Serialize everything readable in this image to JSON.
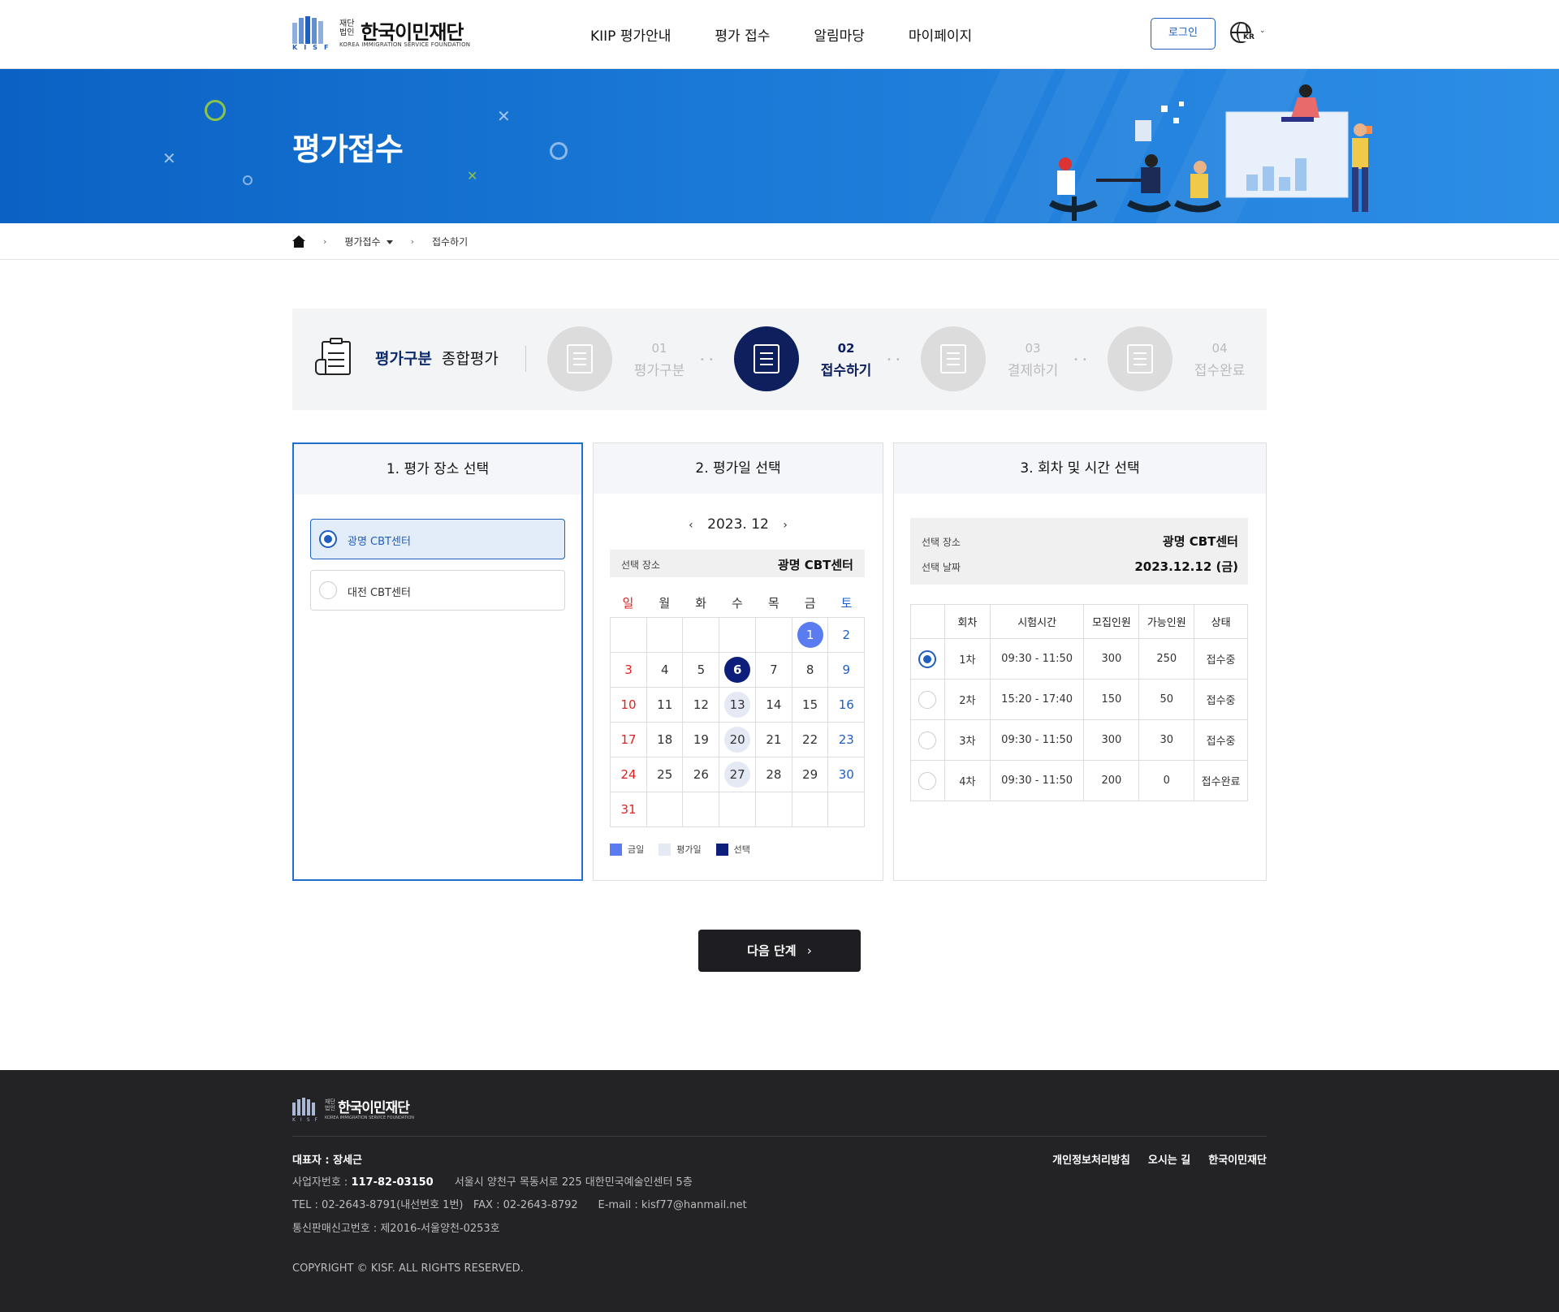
{
  "header": {
    "logo_small": "재단\n법인",
    "logo_name": "한국이민재단",
    "logo_en": "KOREA IMMIGRATION SERVICE FOUNDATION",
    "logo_kisf": "KISF",
    "nav": [
      "KIIP 평가안내",
      "평가 접수",
      "알림마당",
      "마이페이지"
    ],
    "login_label": "로그인",
    "lang_label": "KR"
  },
  "banner": {
    "title": "평가접수"
  },
  "breadcrumb": {
    "level1": "평가접수",
    "level2": "접수하기"
  },
  "steps": {
    "eval_label": "평가구분",
    "eval_value": "종합평가",
    "items": [
      {
        "num": "01",
        "label": "평가구분",
        "icon": "hand-pencil-icon"
      },
      {
        "num": "02",
        "label": "접수하기",
        "icon": "form-writing-icon"
      },
      {
        "num": "03",
        "label": "결제하기",
        "icon": "card-payment-icon"
      },
      {
        "num": "04",
        "label": "접수완료",
        "icon": "document-complete-icon"
      }
    ]
  },
  "panel1": {
    "title": "1. 평가 장소 선택",
    "locations": [
      {
        "name": "광명 CBT센터",
        "selected": true
      },
      {
        "name": "대전 CBT센터",
        "selected": false
      }
    ]
  },
  "panel2": {
    "title": "2. 평가일 선택",
    "month": "2023. 12",
    "prev": "‹",
    "next": "›",
    "place_key": "선택 장소",
    "place_value": "광명 CBT센터",
    "weekdays": [
      "일",
      "월",
      "화",
      "수",
      "목",
      "금",
      "토"
    ],
    "weeks": [
      [
        "",
        "",
        "",
        "",
        "",
        "1",
        "2"
      ],
      [
        "3",
        "4",
        "5",
        "6",
        "7",
        "8",
        "9"
      ],
      [
        "10",
        "11",
        "12",
        "13",
        "14",
        "15",
        "16"
      ],
      [
        "17",
        "18",
        "19",
        "20",
        "21",
        "22",
        "23"
      ],
      [
        "24",
        "25",
        "26",
        "27",
        "28",
        "29",
        "30"
      ],
      [
        "31",
        "",
        "",
        "",
        "",
        "",
        ""
      ]
    ],
    "legend": [
      {
        "label": "금일",
        "color": "#5a7cf0"
      },
      {
        "label": "평가일",
        "color": "#e5e9f4"
      },
      {
        "label": "선택",
        "color": "#0d1f7a"
      }
    ]
  },
  "panel3": {
    "title": "3. 회차 및 시간 선택",
    "place_key": "선택 장소",
    "place_value": "광명 CBT센터",
    "date_key": "선택 날짜",
    "date_value": "2023.12.12 (금)",
    "columns": [
      "",
      "회차",
      "시험시간",
      "모집인원",
      "가능인원",
      "상태"
    ],
    "rows": [
      {
        "round": "1차",
        "time": "09:30 - 11:50",
        "quota": "300",
        "avail": "250",
        "status": "접수중",
        "selected": true
      },
      {
        "round": "2차",
        "time": "15:20 - 17:40",
        "quota": "150",
        "avail": "50",
        "status": "접수중",
        "selected": false
      },
      {
        "round": "3차",
        "time": "09:30 - 11:50",
        "quota": "300",
        "avail": "30",
        "status": "접수중",
        "selected": false
      },
      {
        "round": "4차",
        "time": "09:30 - 11:50",
        "quota": "200",
        "avail": "0",
        "status": "접수완료",
        "selected": false
      }
    ]
  },
  "next_button": "다음 단계",
  "footer": {
    "logo_small": "재단\n법인",
    "logo_name": "한국이민재단",
    "logo_en": "KOREA IMMIGRATION SERVICE FOUNDATION",
    "logo_kisf": "KISF",
    "representative": "대표자 : 장세근",
    "biz_label": "사업자번호 : ",
    "biz_number": "117-82-03150",
    "address": "서울시 양천구 목동서로 225 대한민국예술인센터 5층",
    "contact": "TEL : 02-2643-8791(내선번호 1번)   FAX : 02-2643-8792      E-mail : kisf77@hanmail.net",
    "mail_order": "통신판매신고번호 : 제2016-서울양천-0253호",
    "links": [
      "개인정보처리방침",
      "오시는 길",
      "한국이민재단"
    ],
    "copyright": "COPYRIGHT © KISF. ALL RIGHTS RESERVED."
  }
}
